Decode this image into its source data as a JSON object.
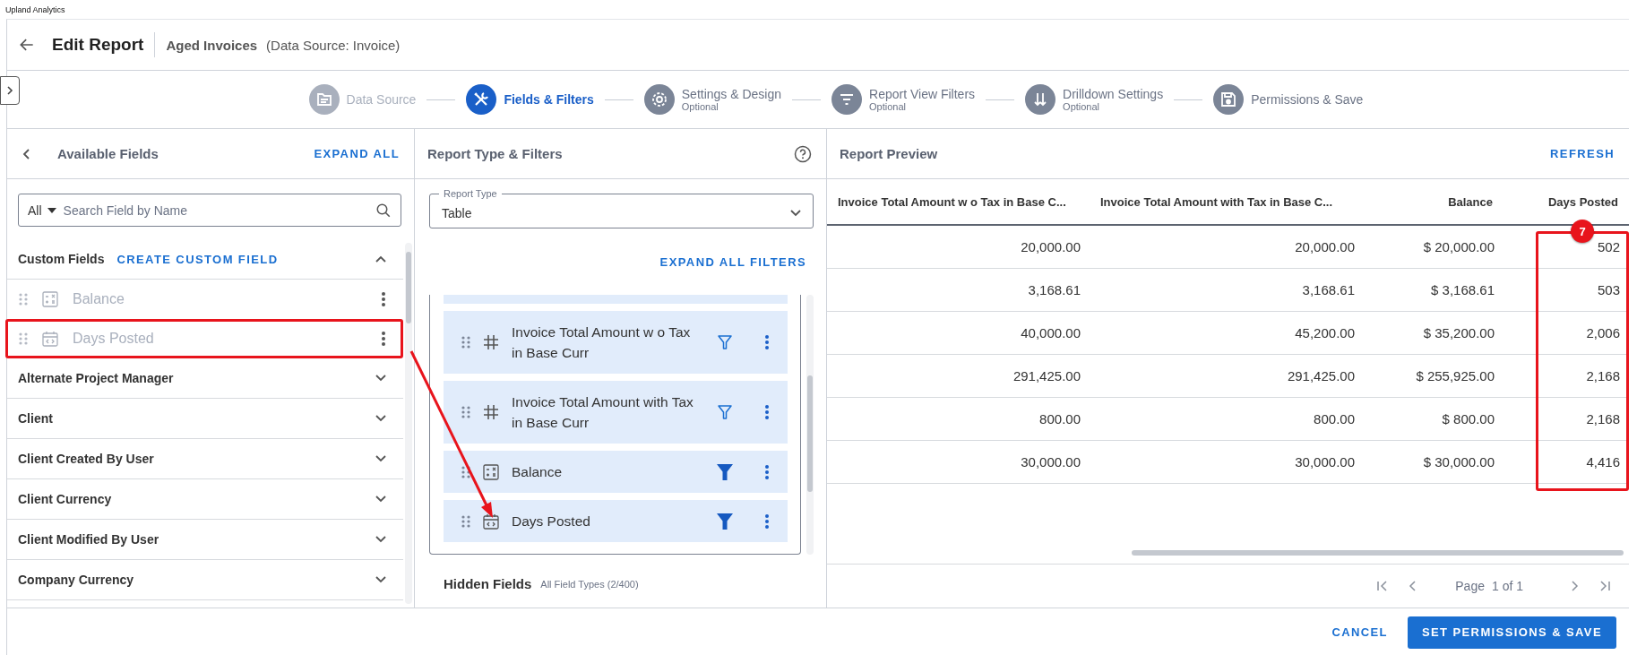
{
  "app_title": "Upland Analytics",
  "header": {
    "title": "Edit Report",
    "report_name": "Aged Invoices",
    "data_source": "(Data Source: Invoice)"
  },
  "steps": [
    {
      "label": "Data Source",
      "kind": "folder",
      "selected": false,
      "completed": true
    },
    {
      "label": "Fields & Filters",
      "kind": "tools",
      "selected": true,
      "completed": false
    },
    {
      "label": "Settings & Design",
      "sublabel": "Optional",
      "kind": "gear",
      "selected": false,
      "completed": false
    },
    {
      "label": "Report View Filters",
      "sublabel": "Optional",
      "kind": "filter",
      "selected": false,
      "completed": false
    },
    {
      "label": "Drilldown Settings",
      "sublabel": "Optional",
      "kind": "arrows",
      "selected": false,
      "completed": false
    },
    {
      "label": "Permissions & Save",
      "kind": "save",
      "selected": false,
      "completed": false
    }
  ],
  "available_fields": {
    "title": "Available Fields",
    "expand_all": "EXPAND ALL",
    "search": {
      "scope": "All",
      "placeholder": "Search Field by Name"
    },
    "groups": [
      {
        "name": "Custom Fields",
        "action": "CREATE CUSTOM FIELD",
        "expanded": true,
        "children": [
          {
            "name": "Balance",
            "kind": "calculator",
            "disabled": true,
            "highlighted": false
          },
          {
            "name": "Days Posted",
            "kind": "calendar",
            "disabled": true,
            "highlighted": true
          }
        ]
      },
      {
        "name": "Alternate Project Manager",
        "expanded": false
      },
      {
        "name": "Client",
        "expanded": false
      },
      {
        "name": "Client Created By User",
        "expanded": false
      },
      {
        "name": "Client Currency",
        "expanded": false
      },
      {
        "name": "Client Modified By User",
        "expanded": false
      },
      {
        "name": "Company Currency",
        "expanded": false
      }
    ]
  },
  "filters_panel": {
    "title": "Report Type & Filters",
    "report_type": {
      "label": "Report Type",
      "value": "Table"
    },
    "expand_all": "EXPAND ALL FILTERS",
    "fields": [
      {
        "name": "Invoice Total Amount w o Tax in Base Curr",
        "kind": "number",
        "filter_active": false
      },
      {
        "name": "Invoice Total Amount with Tax in Base Curr",
        "kind": "number",
        "filter_active": false
      },
      {
        "name": "Balance",
        "kind": "calculator",
        "filter_active": true
      },
      {
        "name": "Days Posted",
        "kind": "calendar",
        "filter_active": true
      }
    ],
    "hidden_fields": {
      "title": "Hidden Fields",
      "note": "All Field Types (2/400)"
    }
  },
  "preview": {
    "title": "Report Preview",
    "refresh": "REFRESH",
    "columns": [
      {
        "label": "Invoice Total Amount w o Tax in Base C...",
        "highlighted": false
      },
      {
        "label": "Invoice Total Amount with Tax in Base C...",
        "highlighted": false
      },
      {
        "label": "Balance",
        "highlighted": false
      },
      {
        "label": "Days Posted",
        "highlighted": true,
        "callout": "7"
      }
    ],
    "rows": [
      [
        "20,000.00",
        "20,000.00",
        "$ 20,000.00",
        "502"
      ],
      [
        "3,168.61",
        "3,168.61",
        "$ 3,168.61",
        "503"
      ],
      [
        "40,000.00",
        "45,200.00",
        "$ 35,200.00",
        "2,006"
      ],
      [
        "291,425.00",
        "291,425.00",
        "$ 255,925.00",
        "2,168"
      ],
      [
        "800.00",
        "800.00",
        "$ 800.00",
        "2,168"
      ],
      [
        "30,000.00",
        "30,000.00",
        "$ 30,000.00",
        "4,416"
      ]
    ],
    "pager": {
      "page_label": "Page",
      "page_value": "1 of 1"
    }
  },
  "footer": {
    "cancel": "CANCEL",
    "save": "SET PERMISSIONS & SAVE"
  }
}
